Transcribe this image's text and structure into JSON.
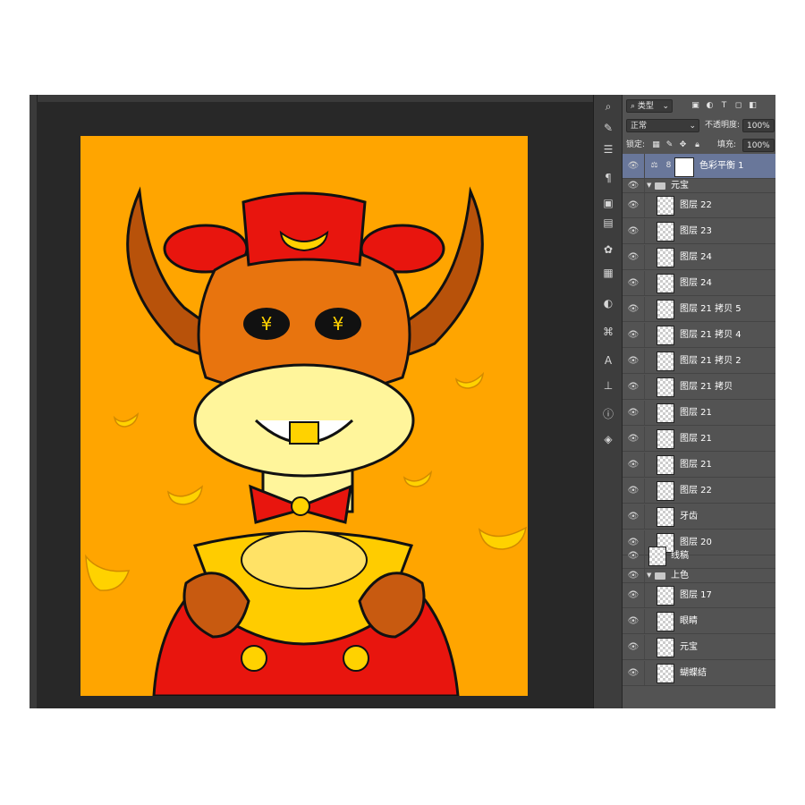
{
  "colors": {
    "canvas_bg": "#ffa500",
    "panel_bg": "#535353",
    "selected_layer": "#69779a",
    "app_bg": "#282828"
  },
  "layers_panel": {
    "filter_label": "类型",
    "blend_mode": "正常",
    "opacity_label": "不透明度:",
    "opacity_value": "100%",
    "lock_label": "锁定:",
    "fill_label": "填充:",
    "fill_value": "100%",
    "adjustment_layer": "色彩平衡 1",
    "groups": [
      {
        "name": "元宝",
        "layers": [
          "图层 22",
          "图层 23",
          "图层 24",
          "图层 24",
          "图层 21 拷贝 5",
          "图层 21 拷贝 4",
          "图层 21 拷贝 2",
          "图层 21 拷贝",
          "图层 21",
          "图层 21",
          "图层 21",
          "图层 22",
          "牙齿",
          "图层 20"
        ]
      },
      {
        "name": "线稿",
        "is_layer": true
      },
      {
        "name": "上色",
        "layers": [
          "图层 17",
          "眼睛",
          "元宝",
          "蝴蝶结"
        ]
      }
    ]
  },
  "artwork": {
    "hat_symbol": "¥",
    "eye_symbol": "¥"
  },
  "icons": [
    "search-icon",
    "adjustment-icon",
    "folder-icon",
    "eye-icon",
    "lock-icon",
    "move-icon",
    "brush-icon",
    "type-icon",
    "info-icon"
  ]
}
